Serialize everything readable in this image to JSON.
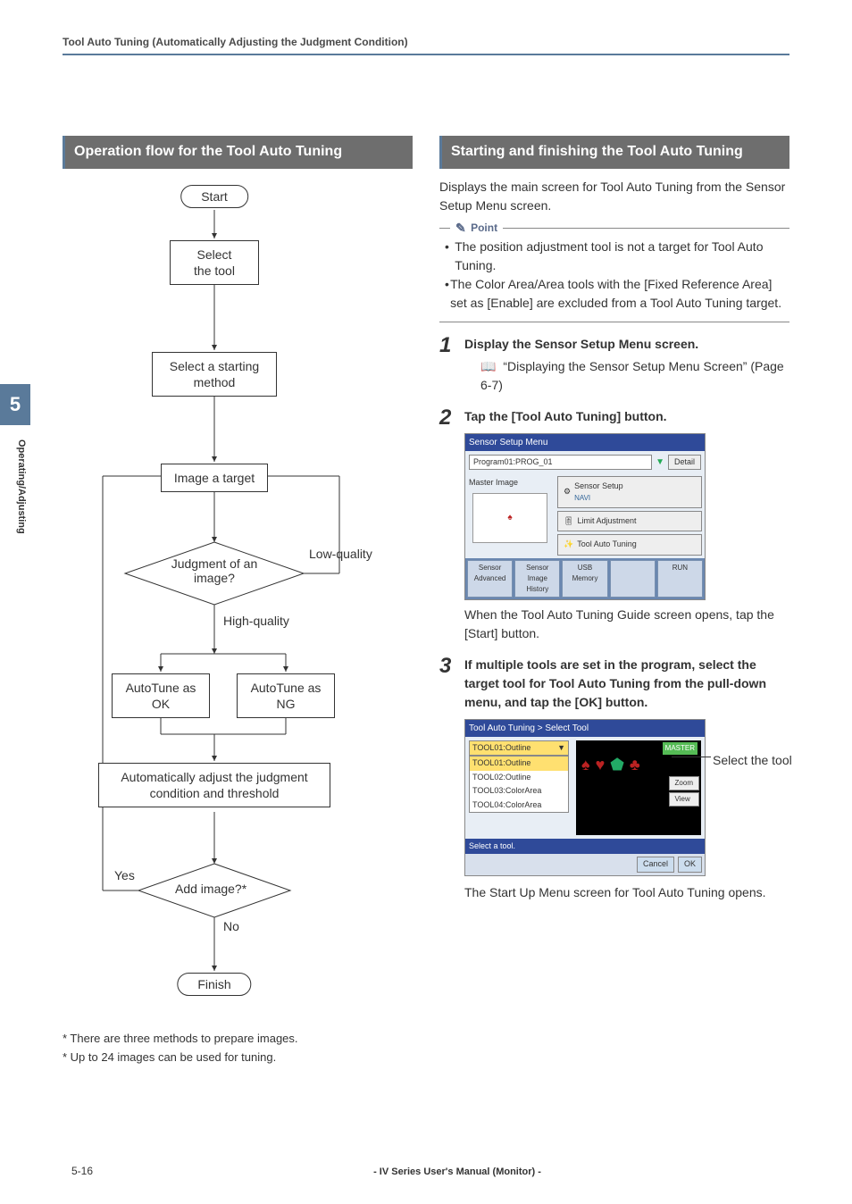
{
  "header": {
    "running": "Tool Auto Tuning (Automatically Adjusting the Judgment Condition)"
  },
  "spine": {
    "chapter": "5",
    "section": "Operating/Adjusting"
  },
  "left": {
    "title": "Operation flow for the Tool Auto Tuning",
    "flow": {
      "start": "Start",
      "select_tool": "Select\nthe tool",
      "select_method": "Select a starting\nmethod",
      "image_target": "Image a target",
      "judge": "Judgment of an\nimage?",
      "low": "Low-quality",
      "high": "High-quality",
      "at_ok": "AutoTune as\nOK",
      "at_ng": "AutoTune as\nNG",
      "adjust": "Automatically adjust the judgment\ncondition and threshold",
      "add": "Add image?*",
      "yes": "Yes",
      "no": "No",
      "finish": "Finish"
    },
    "notes": {
      "n1": "*     There are three methods to prepare images.",
      "n2": "*     Up to 24 images can be used for tuning."
    }
  },
  "right": {
    "title": "Starting and finishing the Tool Auto Tuning",
    "lead": "Displays the main screen for Tool Auto Tuning from the Sensor Setup Menu screen.",
    "point_label": "Point",
    "points": {
      "p1": "The position adjustment tool is not a target for Tool Auto Tuning.",
      "p2": "The Color Area/Area tools with the [Fixed Reference Area] set as [Enable] are excluded from a Tool Auto Tuning target."
    },
    "steps": {
      "s1": {
        "num": "1",
        "title": "Display the Sensor Setup Menu screen.",
        "ref": "“Displaying the Sensor Setup Menu Screen” (Page 6-7)"
      },
      "s2": {
        "num": "2",
        "title": "Tap the [Tool Auto Tuning] button.",
        "after": "When the Tool Auto Tuning Guide screen opens, tap the [Start] button."
      },
      "s3": {
        "num": "3",
        "title": "If multiple tools are set in the program, select the target tool for Tool Auto Tuning from the pull-down menu, and tap the [OK] button.",
        "callout": "Select the tool",
        "after": "The Start Up Menu screen for Tool Auto Tuning opens."
      }
    },
    "sshot1": {
      "title": "Sensor Setup Menu",
      "program": "Program01:PROG_01",
      "detail": "Detail",
      "master": "Master Image",
      "navi_label": "NAVI",
      "navi_btn": "Sensor Setup",
      "limit_btn": "Limit Adjustment",
      "tool_btn": "Tool Auto Tuning",
      "f1": "Sensor Advanced",
      "f2": "Sensor Image History",
      "f3": "USB Memory",
      "f4": "",
      "f5": "RUN"
    },
    "sshot2": {
      "title": "Tool Auto Tuning > Select Tool",
      "sel": "TOOL01:Outline",
      "opts": [
        "TOOL01:Outline",
        "TOOL02:Outline",
        "TOOL03:ColorArea",
        "TOOL04:ColorArea"
      ],
      "master": "MASTER",
      "zoom": "Zoom",
      "view": "View",
      "prompt": "Select a tool.",
      "cancel": "Cancel",
      "ok": "OK"
    }
  },
  "footer": {
    "page": "5-16",
    "doc": "- IV Series User's Manual (Monitor) -"
  }
}
